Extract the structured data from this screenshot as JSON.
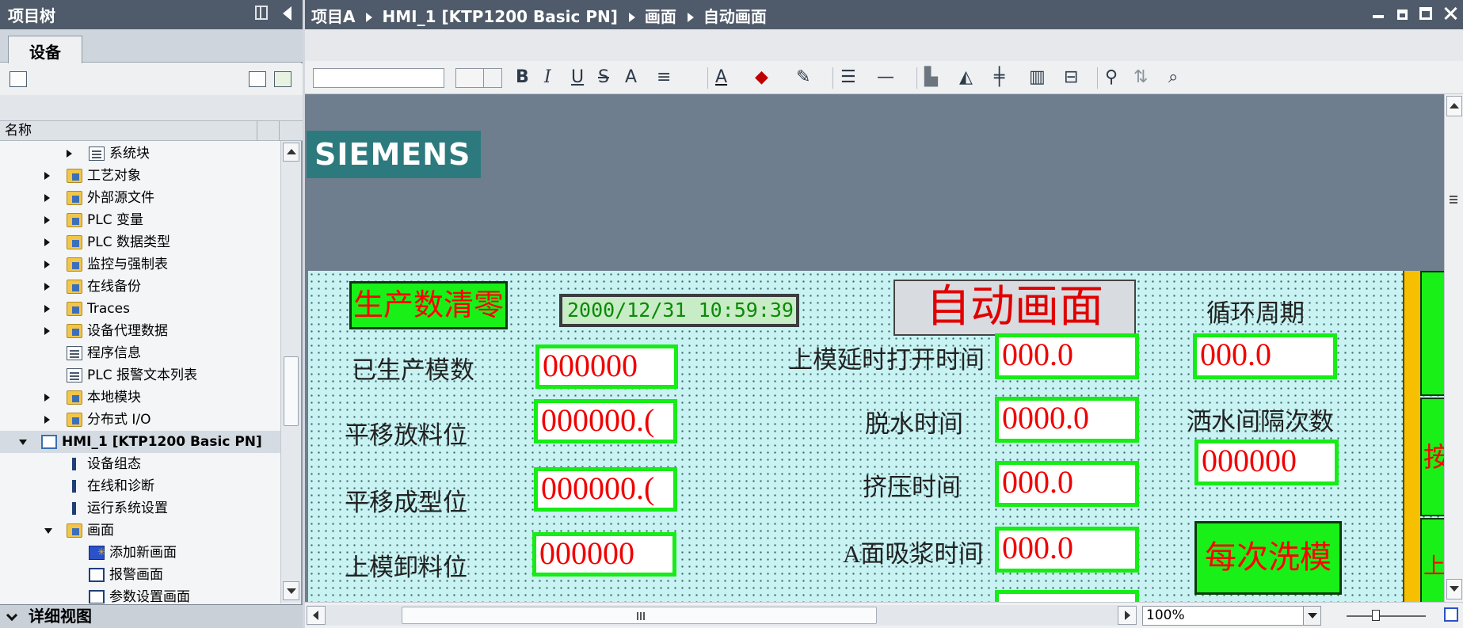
{
  "left_panel": {
    "title": "项目树",
    "tab": "设备",
    "column_header": "名称",
    "tree": [
      {
        "label": "系统块",
        "level": 4,
        "expand": "closed",
        "icon": "system-block-icon"
      },
      {
        "label": "工艺对象",
        "level": 3,
        "expand": "closed",
        "icon": "folder-icon"
      },
      {
        "label": "外部源文件",
        "level": 3,
        "expand": "closed",
        "icon": "folder-icon"
      },
      {
        "label": "PLC 变量",
        "level": 3,
        "expand": "closed",
        "icon": "folder-icon"
      },
      {
        "label": "PLC 数据类型",
        "level": 3,
        "expand": "closed",
        "icon": "folder-icon"
      },
      {
        "label": "监控与强制表",
        "level": 3,
        "expand": "closed",
        "icon": "folder-icon"
      },
      {
        "label": "在线备份",
        "level": 3,
        "expand": "closed",
        "icon": "folder-icon"
      },
      {
        "label": "Traces",
        "level": 3,
        "expand": "closed",
        "icon": "folder-icon"
      },
      {
        "label": "设备代理数据",
        "level": 3,
        "expand": "closed",
        "icon": "folder-icon"
      },
      {
        "label": "程序信息",
        "level": 3,
        "expand": "none",
        "icon": "doc-icon"
      },
      {
        "label": "PLC 报警文本列表",
        "level": 3,
        "expand": "none",
        "icon": "doc-icon"
      },
      {
        "label": "本地模块",
        "level": 3,
        "expand": "closed",
        "icon": "folder-icon"
      },
      {
        "label": "分布式 I/O",
        "level": 3,
        "expand": "closed",
        "icon": "folder-icon"
      },
      {
        "label": "HMI_1 [KTP1200 Basic PN]",
        "level": 1,
        "expand": "open",
        "icon": "hmi-icon",
        "bold": true,
        "selected": true
      },
      {
        "label": "设备组态",
        "level": 3,
        "expand": "none",
        "icon": "tool-icon"
      },
      {
        "label": "在线和诊断",
        "level": 3,
        "expand": "none",
        "icon": "tool-icon"
      },
      {
        "label": "运行系统设置",
        "level": 3,
        "expand": "none",
        "icon": "tool-icon"
      },
      {
        "label": "画面",
        "level": 3,
        "expand": "open",
        "icon": "folder-icon"
      },
      {
        "label": "添加新画面",
        "level": 4,
        "expand": "none",
        "icon": "add-screen-icon"
      },
      {
        "label": "报警画面",
        "level": 4,
        "expand": "none",
        "icon": "screen-icon"
      },
      {
        "label": "参数设置画面",
        "level": 4,
        "expand": "none",
        "icon": "screen-icon"
      }
    ],
    "detail_view": "详细视图"
  },
  "breadcrumb": [
    "项目A",
    "HMI_1 [KTP1200 Basic PN]",
    "画面",
    "自动画面"
  ],
  "toolbar": {
    "bold": "B",
    "italic": "I",
    "underline": "U",
    "strike": "S",
    "superscript": "A"
  },
  "hmi": {
    "logo": "SIEMENS",
    "reset_button": "生产数清零",
    "datetime": "2000/12/31 10:59:39",
    "screen_title": "自动画面",
    "cycle_label": "循环周期",
    "cycle_value": "000.0",
    "labels_left": [
      {
        "label": "已生产模数",
        "value": "000000"
      },
      {
        "label": "平移放料位",
        "value": "000000.("
      },
      {
        "label": "平移成型位",
        "value": "000000.("
      },
      {
        "label": "上模卸料位",
        "value": "000000"
      }
    ],
    "labels_mid": [
      {
        "label": "上模延时打开时间",
        "value": "000.0"
      },
      {
        "label": "脱水时间",
        "value": "0000.0"
      },
      {
        "label": "挤压时间",
        "value": "000.0"
      },
      {
        "label": "A面吸浆时间",
        "value": "000.0"
      }
    ],
    "spray_label": "洒水间隔次数",
    "spray_value": "000000",
    "wash_button": "每次洗模",
    "strip_chars": [
      "按",
      "上"
    ]
  },
  "zoom": "100%",
  "colors": {
    "header_bg": "#4f5b6a",
    "hmi_bg": "#c9f3f3",
    "button_green": "#18f018",
    "value_red": "#f00000",
    "siemens_teal": "#2c7a7e"
  }
}
